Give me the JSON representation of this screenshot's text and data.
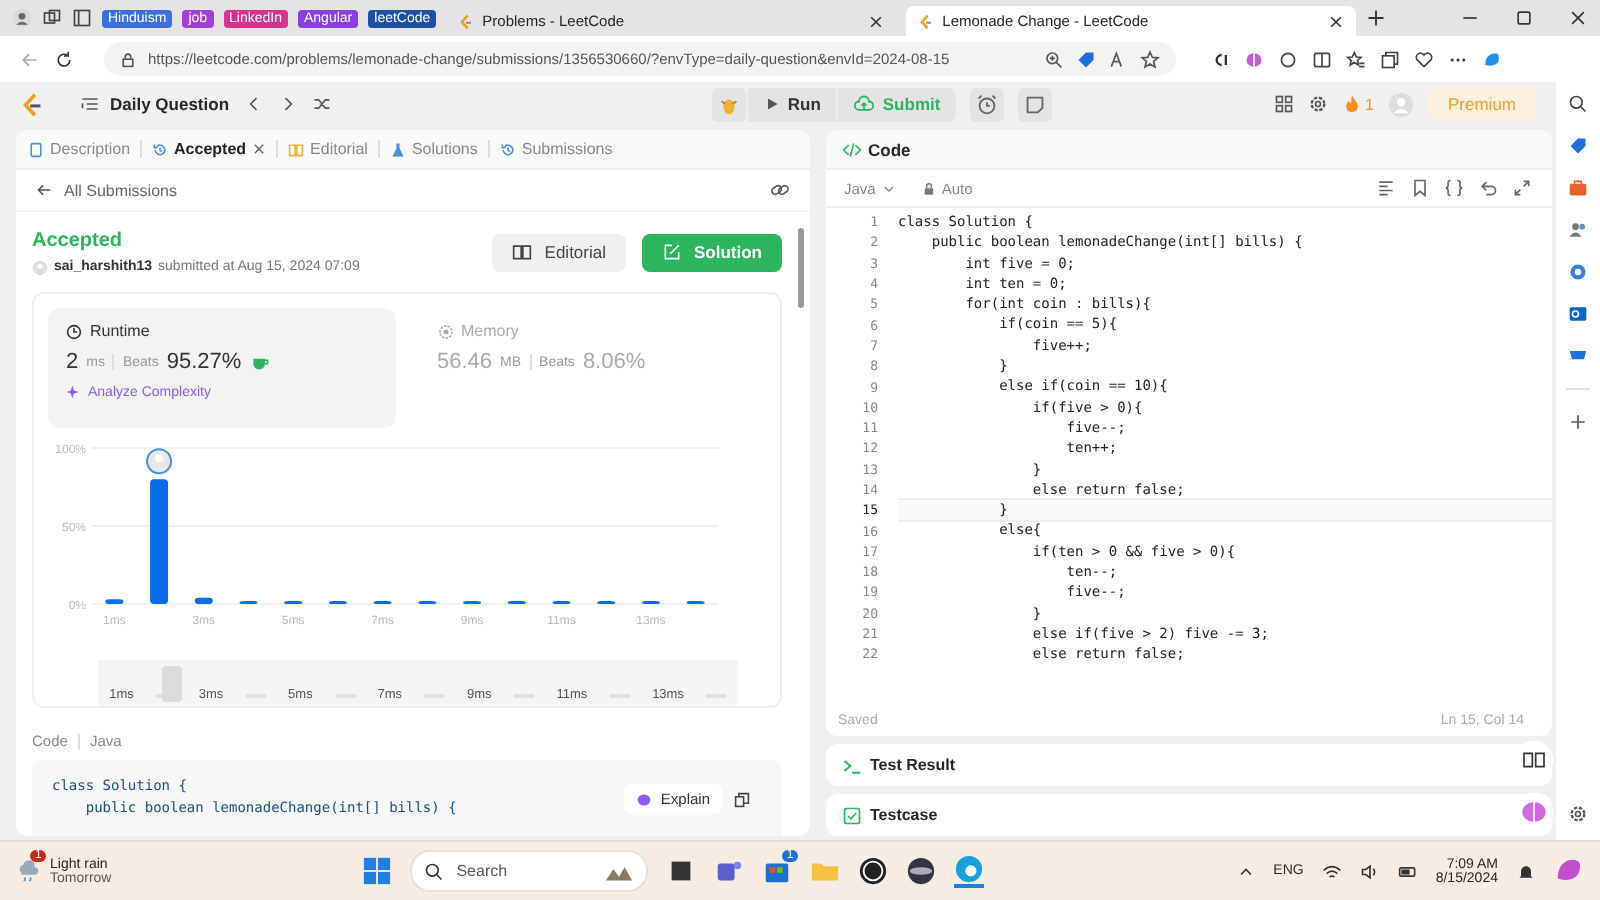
{
  "browser": {
    "tab_groups": [
      {
        "label": "Hinduism",
        "color": "#3b6fe0"
      },
      {
        "label": "job",
        "color": "#a23fd6"
      },
      {
        "label": "LinkedIn",
        "color": "#d6338f"
      },
      {
        "label": "Angular",
        "color": "#8b3fe0"
      },
      {
        "label": "leetCode",
        "color": "#1f4fa0"
      }
    ],
    "tabs": [
      {
        "title": "Problems - LeetCode",
        "selected": false
      },
      {
        "title": "Lemonade Change - LeetCode",
        "selected": true
      }
    ],
    "url": "https://leetcode.com/problems/lemonade-change/submissions/1356530660/?envType=daily-question&envId=2024-08-15"
  },
  "toolbar": {
    "title": "Daily Question",
    "run": "Run",
    "submit": "Submit",
    "streak": "1",
    "premium": "Premium"
  },
  "left_tabs": [
    {
      "kind": "description",
      "label": "Description",
      "selected": false,
      "closable": false
    },
    {
      "kind": "accepted",
      "label": "Accepted",
      "selected": true,
      "closable": true
    },
    {
      "kind": "editorial",
      "label": "Editorial",
      "selected": false,
      "closable": false
    },
    {
      "kind": "solutions",
      "label": "Solutions",
      "selected": false,
      "closable": false
    },
    {
      "kind": "submissions",
      "label": "Submissions",
      "selected": false,
      "closable": false
    }
  ],
  "back_link": "All Submissions",
  "submission": {
    "status": "Accepted",
    "author": "sai_harshith13",
    "submitted": "submitted at Aug 15, 2024 07:09",
    "editorial_button": "Editorial",
    "solution_button": "Solution"
  },
  "metrics": [
    {
      "kind": "runtime",
      "label": "Runtime",
      "value": "2",
      "unit": "ms",
      "beats_label": "Beats",
      "beats": "95.27%",
      "selected": true,
      "action": "Analyze Complexity"
    },
    {
      "kind": "memory",
      "label": "Memory",
      "value": "56.46",
      "unit": "MB",
      "beats_label": "Beats",
      "beats": "8.06%",
      "selected": false
    }
  ],
  "chart_data": {
    "type": "bar",
    "x": [
      1,
      2,
      3,
      4,
      5,
      6,
      7,
      8,
      9,
      10,
      11,
      12,
      13,
      14
    ],
    "values": [
      3,
      80,
      4,
      2,
      2,
      2,
      2,
      2,
      2,
      2,
      2,
      2,
      2,
      2
    ],
    "xlim": [
      0.5,
      14.5
    ],
    "ylim": [
      0,
      100
    ],
    "yticks": [
      {
        "value": 0,
        "label": "0%"
      },
      {
        "value": 50,
        "label": "50%"
      },
      {
        "value": 100,
        "label": "100%"
      }
    ],
    "xticks": [
      {
        "value": 1,
        "label": "1ms"
      },
      {
        "value": 3,
        "label": "3ms"
      },
      {
        "value": 5,
        "label": "5ms"
      },
      {
        "value": 7,
        "label": "7ms"
      },
      {
        "value": 9,
        "label": "9ms"
      },
      {
        "value": 11,
        "label": "11ms"
      },
      {
        "value": 13,
        "label": "13ms"
      }
    ]
  },
  "range_slider": {
    "level": 0.1,
    "labels": [
      "1ms",
      "3ms",
      "5ms",
      "7ms",
      "9ms",
      "11ms",
      "13ms"
    ]
  },
  "code_preview": {
    "label": "Code",
    "language": "Java",
    "explain": "Explain",
    "lines": [
      "class Solution {",
      "    public boolean lemonadeChange(int[] bills) {"
    ]
  },
  "editor": {
    "title": "Code",
    "language": "Java",
    "mode": "Auto",
    "lines": [
      {
        "n": "1",
        "text": "class Solution {",
        "current": false
      },
      {
        "n": "2",
        "text": "    public boolean lemonadeChange(int[] bills) {",
        "current": false
      },
      {
        "n": "3",
        "text": "        int five = 0;",
        "current": false
      },
      {
        "n": "4",
        "text": "        int ten = 0;",
        "current": false
      },
      {
        "n": "5",
        "text": "        for(int coin : bills){",
        "current": false
      },
      {
        "n": "6",
        "text": "            if(coin == 5){",
        "current": false
      },
      {
        "n": "7",
        "text": "                five++;",
        "current": false
      },
      {
        "n": "8",
        "text": "            }",
        "current": false
      },
      {
        "n": "9",
        "text": "            else if(coin == 10){",
        "current": false
      },
      {
        "n": "10",
        "text": "                if(five > 0){",
        "current": false
      },
      {
        "n": "11",
        "text": "                    five--;",
        "current": false
      },
      {
        "n": "12",
        "text": "                    ten++;",
        "current": false
      },
      {
        "n": "13",
        "text": "                }",
        "current": false
      },
      {
        "n": "14",
        "text": "                else return false;",
        "current": false
      },
      {
        "n": "15",
        "text": "            }",
        "current": true
      },
      {
        "n": "16",
        "text": "            else{",
        "current": false
      },
      {
        "n": "17",
        "text": "                if(ten > 0 && five > 0){",
        "current": false
      },
      {
        "n": "18",
        "text": "                    ten--;",
        "current": false
      },
      {
        "n": "19",
        "text": "                    five--;",
        "current": false
      },
      {
        "n": "20",
        "text": "                }",
        "current": false
      },
      {
        "n": "21",
        "text": "                else if(five > 2) five -= 3;",
        "current": false
      },
      {
        "n": "22",
        "text": "                else return false;",
        "current": false
      }
    ],
    "saved": "Saved",
    "position": "Ln 15, Col 14"
  },
  "bottom_panels": [
    {
      "kind": "result",
      "label": "Test Result"
    },
    {
      "kind": "testcase",
      "label": "Testcase"
    }
  ],
  "taskbar": {
    "weather": "Light rain",
    "weather_sub": "Tomorrow",
    "weather_badge": "1",
    "search": "Search",
    "store_badge": "1",
    "language": "ENG",
    "time": "7:09 AM",
    "date": "8/15/2024"
  }
}
